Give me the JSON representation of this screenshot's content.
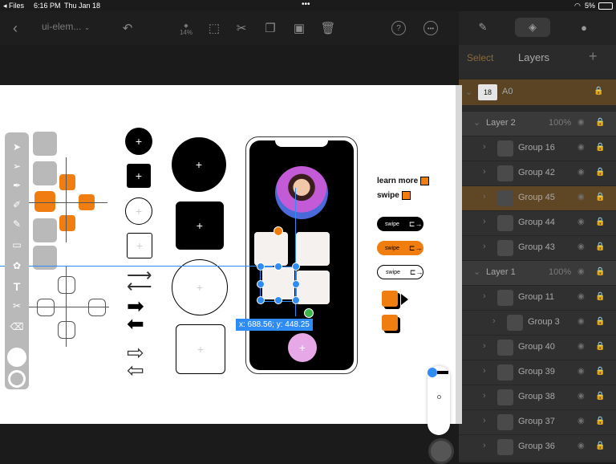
{
  "status_bar": {
    "back_app": "Files",
    "time": "6:16 PM",
    "date": "Thu Jan 18",
    "battery": "5%"
  },
  "toolbar": {
    "doc_title": "ui-elem...",
    "zoom": "14%"
  },
  "panel": {
    "select_label": "Select",
    "title": "Layers",
    "artboard": {
      "name": "A0",
      "badge": "18"
    },
    "layers": [
      {
        "name": "Layer 2",
        "opacity": "100%",
        "indent": 1,
        "type": "layer"
      },
      {
        "name": "Group 16",
        "indent": 2,
        "type": "group"
      },
      {
        "name": "Group 42",
        "indent": 2,
        "type": "group"
      },
      {
        "name": "Group 45",
        "indent": 2,
        "type": "group",
        "selected": true
      },
      {
        "name": "Group 44",
        "indent": 2,
        "type": "group"
      },
      {
        "name": "Group 43",
        "indent": 2,
        "type": "group"
      },
      {
        "name": "Layer 1",
        "opacity": "100%",
        "indent": 1,
        "type": "layer"
      },
      {
        "name": "Group 11",
        "indent": 2,
        "type": "group"
      },
      {
        "name": "Group 3",
        "indent": 3,
        "type": "group"
      },
      {
        "name": "Group 40",
        "indent": 2,
        "type": "group"
      },
      {
        "name": "Group 39",
        "indent": 2,
        "type": "group"
      },
      {
        "name": "Group 38",
        "indent": 2,
        "type": "group"
      },
      {
        "name": "Group 37",
        "indent": 2,
        "type": "group"
      },
      {
        "name": "Group 36",
        "indent": 2,
        "type": "group"
      }
    ]
  },
  "canvas": {
    "learn_more": "learn more",
    "swipe": "swipe",
    "swipe_pill_1": "swipe",
    "swipe_pill_2": "swipe",
    "swipe_pill_3": "swipe",
    "coord_readout": "x: 688.56; y: 448.25"
  },
  "colors": {
    "accent_orange": "#ef7d0f",
    "selection_blue": "#2f8cf5",
    "panel_bg": "#2a2a2a",
    "canvas_bg": "#ffffff"
  },
  "icons": [
    "back-icon",
    "undo-icon",
    "transform-icon",
    "scissors-icon",
    "copy-icon",
    "paste-icon",
    "trash-icon",
    "help-icon",
    "more-icon",
    "brush-tab-icon",
    "layers-tab-icon",
    "color-tab-icon",
    "add-layer-icon"
  ]
}
